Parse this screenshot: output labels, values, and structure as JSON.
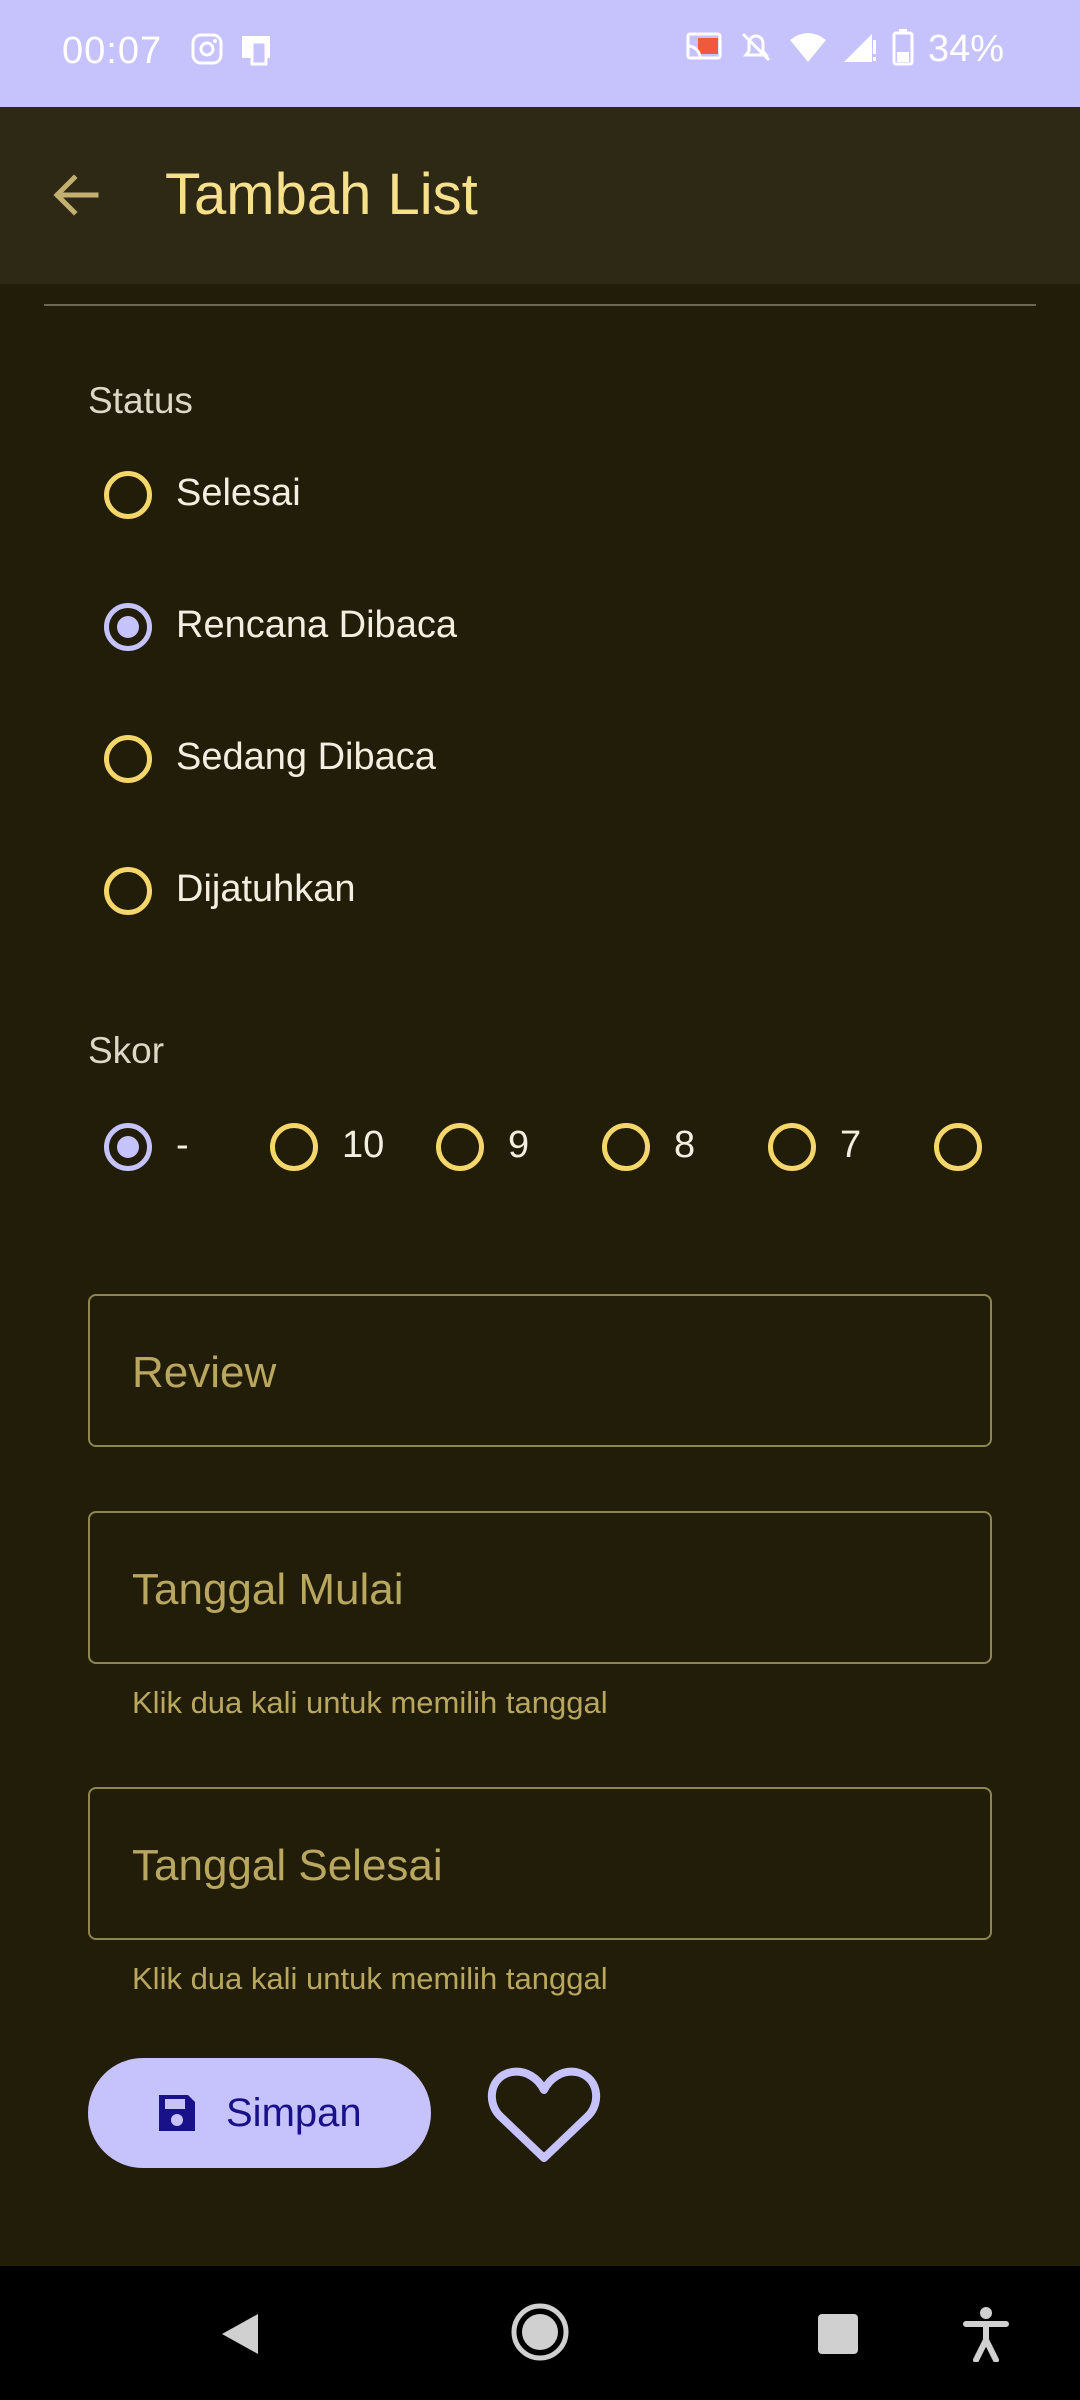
{
  "status_bar": {
    "time": "00:07",
    "battery": "34%",
    "icons_left": [
      "instagram-icon",
      "notification-app-icon"
    ],
    "icons_right": [
      "cast-icon",
      "notifications-off-icon",
      "wifi-icon",
      "signal-icon",
      "battery-icon"
    ]
  },
  "app_bar": {
    "title": "Tambah List",
    "back_icon": "arrow-back-icon"
  },
  "status": {
    "label": "Status",
    "options": [
      "Selesai",
      "Rencana Dibaca",
      "Sedang Dibaca",
      "Dijatuhkan"
    ],
    "selected": "Rencana Dibaca"
  },
  "score": {
    "label": "Skor",
    "options": [
      "-",
      "10",
      "9",
      "8",
      "7",
      ""
    ],
    "selected": "-"
  },
  "fields": {
    "review_placeholder": "Review",
    "start_date_placeholder": "Tanggal Mulai",
    "start_date_helper": "Klik dua kali untuk memilih tanggal",
    "end_date_placeholder": "Tanggal Selesai",
    "end_date_helper": "Klik dua kali untuk memilih tanggal"
  },
  "actions": {
    "save_label": "Simpan",
    "save_icon": "save-icon",
    "favorite_icon": "heart-outline-icon"
  },
  "colors": {
    "background": "#211d08",
    "app_bar": "#2e2914",
    "accent": "#c6c2fc",
    "title": "#f7e08c",
    "radio_unchecked": "#f4d66a"
  }
}
